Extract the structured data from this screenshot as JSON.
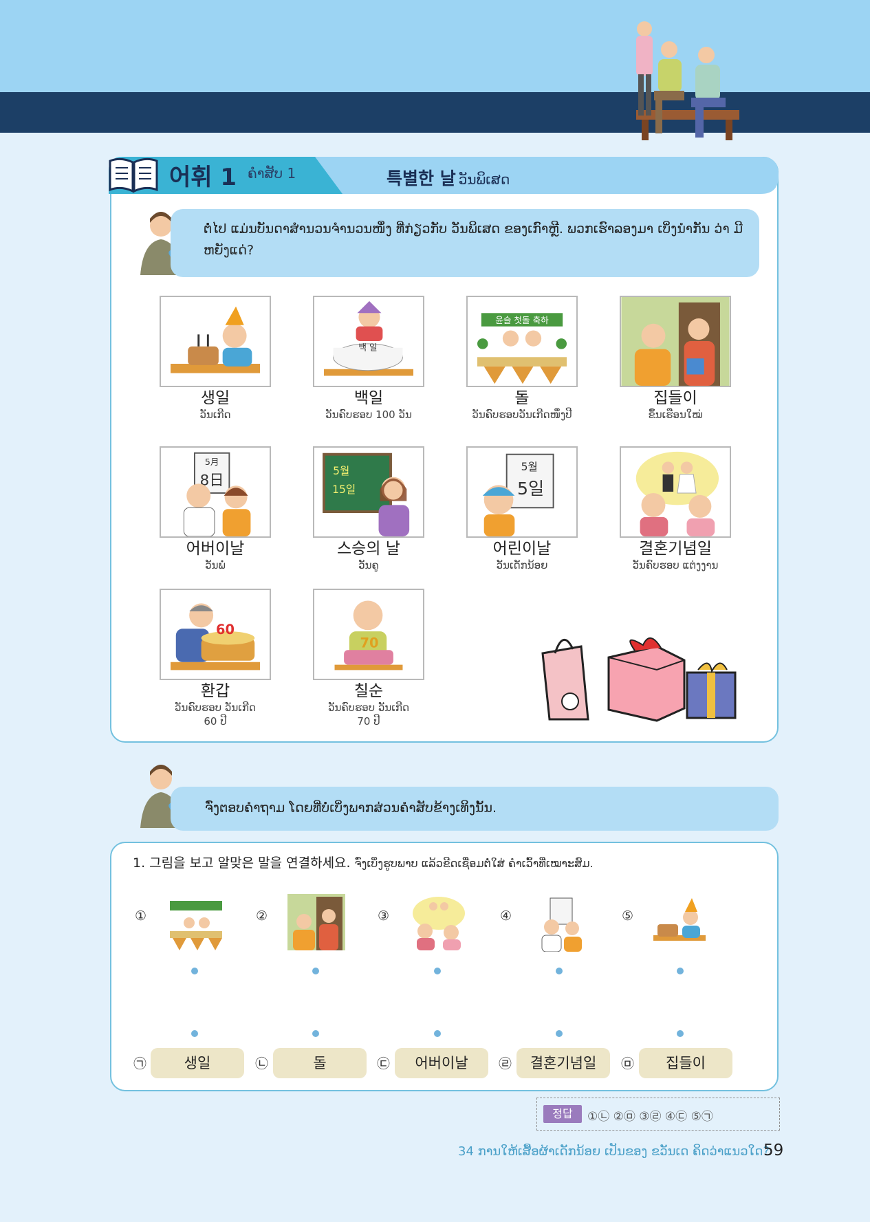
{
  "header": {
    "art": "three-people-on-bench-illustration"
  },
  "section": {
    "title_ko": "어휘 1",
    "title_lo": "ຄຳສັບ 1",
    "topic_ko": "특별한 날",
    "topic_lo": "ວັນພິເສດ"
  },
  "intro": "ຕໍ່ໄປ ແມ່ນບັນດາສຳນວນຈຳນວນໜຶ່ງ ທີ່ກ່ຽວກັບ ວັນພິເສດ ຂອງເກົາຫຼີ. ພວກເຮົາລອງມາ ເບິ່ງນຳກັນ ວ່າ ມີຫຍັງແດ່?",
  "vocab": [
    {
      "ko": "생일",
      "lo": "ວັນເກີດ",
      "pic": "birthday-cake-boy"
    },
    {
      "ko": "백일",
      "lo": "ວັນຄົບຮອບ 100 ວັນ",
      "pic": "baby-hundred-day-cake",
      "cake_text": "백 일"
    },
    {
      "ko": "돌",
      "lo": "ວັນຄົບຮອບວັນເກີດໜຶ່ງປີ",
      "pic": "first-birthday-table",
      "banner": "윤슬 첫돌 축하"
    },
    {
      "ko": "집들이",
      "lo": "ຂຶ້ນເຮືອນໃໝ່",
      "pic": "housewarming-door"
    },
    {
      "ko": "어버이날",
      "lo": "ວັນພໍ່",
      "pic": "parents-day-calendar",
      "calendar": [
        "5月",
        "8日"
      ]
    },
    {
      "ko": "스승의 날",
      "lo": "ວັນຄູ",
      "pic": "teacher-blackboard",
      "board": [
        "5월",
        "15일"
      ]
    },
    {
      "ko": "어린이날",
      "lo": "ວັນເດັກນ້ອຍ",
      "pic": "children-day-calendar",
      "calendar": [
        "5월",
        "5일"
      ]
    },
    {
      "ko": "결혼기념일",
      "lo": "ວັນຄົບຮອບ ແຕ່ງງານ",
      "pic": "wedding-anniversary-couple"
    },
    {
      "ko": "환갑",
      "lo_lines": [
        "ວັນຄົບຮອບ ວັນເກີດ",
        "60 ປີ"
      ],
      "pic": "sixtieth-birthday-cake",
      "cake_num": "60"
    },
    {
      "ko": "칠순",
      "lo_lines": [
        "ວັນຄົບຮອບ ວັນເກີດ",
        "70 ປີ"
      ],
      "pic": "seventieth-birthday-cake",
      "cake_num": "70"
    }
  ],
  "instruction_bubble": "ຈົ່ງຕອບຄຳຖາມ ໂດຍທີ່ບໍ່ເບິ່ງພາກສ່ວນຄຳສັບຂ້າງເທິງນັ້ນ.",
  "exercise": {
    "instruction_ko": "1. 그림을 보고 알맞은 말을 연결하세요.",
    "instruction_lo": "ຈົ່ງເບິ່ງຮູບພາບ ແລ້ວຂີດເຊື່ອມຕໍ່ໃສ່ ຄຳເວົ້າທີ່ເໝາະສົມ.",
    "pictures": [
      {
        "num": "①",
        "pic": "first-birthday-table"
      },
      {
        "num": "②",
        "pic": "housewarming-door"
      },
      {
        "num": "③",
        "pic": "wedding-anniversary-couple"
      },
      {
        "num": "④",
        "pic": "parents-day-calendar"
      },
      {
        "num": "⑤",
        "pic": "birthday-cake-boy"
      }
    ],
    "words": [
      {
        "mark": "㉠",
        "word": "생일"
      },
      {
        "mark": "㉡",
        "word": "돌"
      },
      {
        "mark": "㉢",
        "word": "어버이날"
      },
      {
        "mark": "㉣",
        "word": "결혼기념일"
      },
      {
        "mark": "㉤",
        "word": "집들이"
      }
    ],
    "answer_label": "정답",
    "answers": "①㉡  ②㉤  ③㉣  ④㉢  ⑤㉠"
  },
  "footer": {
    "text": "34 ການໃຫ້ເສື້ອຜ້າເດັກນ້ອຍ ເປັນຂອງ ຂວັນເດ ຄິດວ່າແນວໃດ?",
    "page": "59"
  },
  "colors": {
    "sky": "#9cd4f3",
    "navy": "#1c3f66",
    "page_bg": "#e3f1fb",
    "card_border": "#73c1df",
    "bubble": "#b3ddf5",
    "answer_box": "#ede6c8",
    "answer_label": "#9a7bbd"
  }
}
